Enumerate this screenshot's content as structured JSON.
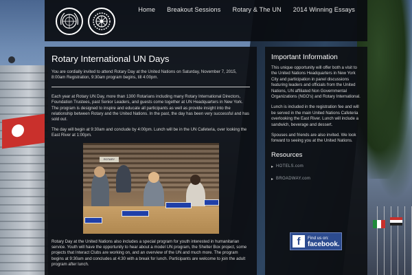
{
  "nav": {
    "items": [
      "Home",
      "Breakout Sessions",
      "Rotary & The UN",
      "2014 Winning Essays"
    ]
  },
  "main": {
    "title": "Rotary International UN Days",
    "intro": "You are cordially invited to attend Rotary Day at the United Nations on Saturday, November 7, 2015, 8:00am Registration, 9:30am program begins, till 4:00pm.",
    "para1": "Each year at Rotary UN Day, more than 1300 Rotarians including many Rotary International Directors, Foundation Trustees, past Senior Leaders, and guests come together at UN Headquarters in New York. The program is designed to inspire and educate all participants as well as provide insight into the relationship between Rotary and the United Nations. In the past, the day has been very successful and has sold out.",
    "para2": "The day will begin at 9:30am and conclude by 4:00pm. Lunch will be in the UN Cafeteria, over looking the East River at 1:00pm.",
    "photo_banner": "ROTARY",
    "para3": "Rotary Day at the United Nations also includes a special program for youth interested in humanitarian service. Youth will have the opportunity to hear about a model UN program, the Shelter Box project, some projects that Interact Clubs are working on, and an overview of the UN and much more. The program begins at 9:30am and concludes at 4:30 with a break for lunch. Participants are welcome to join the adult program after lunch."
  },
  "sidebar": {
    "title": "Important Information",
    "p1": "This unique opportunity will offer both a visit to the United Nations Headquarters in New York City and participation in panel discussions featuring leaders and officials from the United Nations, UN affiliated Non Governmental Organizations (NGO's) and Rotary International.",
    "p2": "Lunch is included in the registration fee and will be served in the main United Nations Cafeteria overlooking the East River. Lunch will include a sandwich, beverage and dessert.",
    "p3": "Spouses and friends are also invited. We look forward to seeing you at the United Nations.",
    "resources_title": "Resources",
    "resources": [
      "HOTELS.com",
      "BROADWAY.com"
    ],
    "facebook_small": "Find us on:",
    "facebook_big": "facebook."
  },
  "colors": {
    "panel": "#0c0e12",
    "facebook": "#2c4b8f",
    "flag_red": "#c9302c"
  },
  "icons": {
    "logo_left": "un-emblem-icon",
    "logo_right": "rotary-wheel-icon",
    "facebook": "facebook-f-icon"
  }
}
